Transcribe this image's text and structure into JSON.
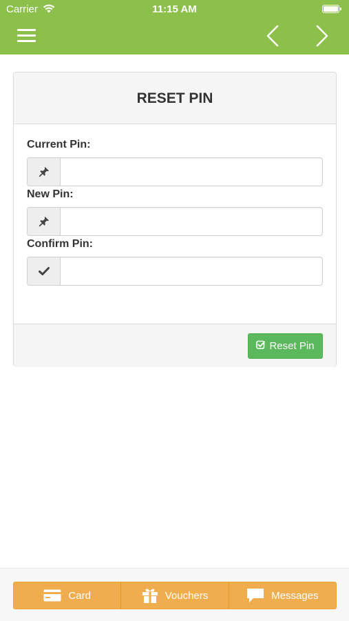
{
  "status_bar": {
    "carrier": "Carrier",
    "time": "11:15 AM",
    "wifi_icon": "wifi-icon",
    "battery_icon": "battery-icon"
  },
  "nav": {
    "menu_icon": "hamburger-menu-icon",
    "back_icon": "chevron-left-icon",
    "forward_icon": "chevron-right-icon",
    "color": "#8cc04b"
  },
  "panel": {
    "title": "RESET PIN",
    "fields": [
      {
        "label": "Current Pin:",
        "icon": "pushpin-icon",
        "value": "",
        "placeholder": ""
      },
      {
        "label": "New Pin:",
        "icon": "pushpin-icon",
        "value": "",
        "placeholder": ""
      },
      {
        "label": "Confirm Pin:",
        "icon": "checkmark-icon",
        "value": "",
        "placeholder": ""
      }
    ],
    "submit_label": "Reset Pin",
    "submit_icon": "check-square-icon",
    "submit_color": "#5cb85c"
  },
  "tabbar": {
    "color": "#f0ad4e",
    "tabs": [
      {
        "label": "Card",
        "icon": "credit-card-icon"
      },
      {
        "label": "Vouchers",
        "icon": "gift-icon"
      },
      {
        "label": "Messages",
        "icon": "chat-bubble-icon"
      }
    ]
  }
}
